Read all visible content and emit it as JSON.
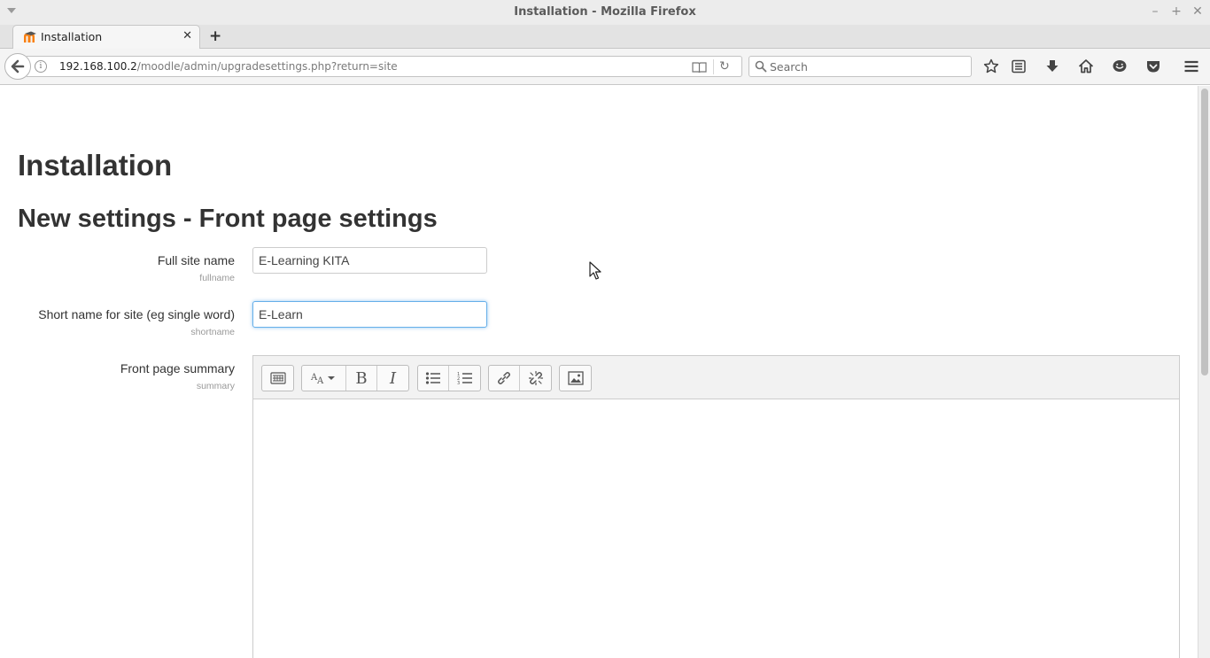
{
  "window": {
    "title": "Installation - Mozilla Firefox"
  },
  "tabs": [
    {
      "label": "Installation",
      "active": true
    }
  ],
  "navbar": {
    "url_host": "192.168.100.2",
    "url_path": "/moodle/admin/upgradesettings.php?return=site",
    "search_placeholder": "Search"
  },
  "page": {
    "heading": "Installation",
    "subheading": "New settings - Front page settings",
    "fields": {
      "fullname": {
        "label": "Full site name",
        "key": "fullname",
        "value": "E-Learning KITA"
      },
      "shortname": {
        "label": "Short name for site (eg single word)",
        "key": "shortname",
        "value": "E-Learn"
      },
      "summary": {
        "label": "Front page summary",
        "key": "summary",
        "value": ""
      }
    }
  },
  "colors": {
    "focus_border": "#66afe9",
    "moodle_orange": "#f98012"
  }
}
